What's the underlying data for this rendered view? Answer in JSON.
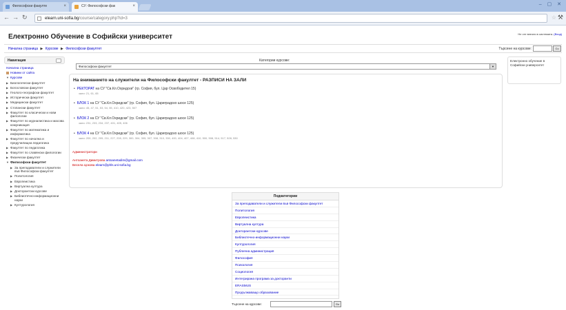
{
  "browser": {
    "tabs": [
      {
        "label": "Философски факулте"
      },
      {
        "label": "СУ: Философски фак"
      }
    ],
    "url_host": "elearn.uni-sofia.bg",
    "url_path": "/course/category.php?id=3"
  },
  "site": {
    "title": "Електронно Обучение в Софийски университет",
    "login_info": "Не сте влезли в системата.",
    "login_link": "(Вход)"
  },
  "breadcrumb": {
    "home": "Начална страница",
    "courses": "Курсове",
    "faculty": "Философски факултет",
    "sep": "▶"
  },
  "top_search": {
    "label": "Търсене на курсове:",
    "button": "Go"
  },
  "left_nav": {
    "title": "Навигация",
    "items": [
      {
        "label": "Начална страница",
        "kind": "link"
      },
      {
        "label": "Новини от сайта",
        "kind": "icon"
      },
      {
        "label": "Курсове",
        "kind": "link-open"
      },
      {
        "label": "Биологически факултет",
        "kind": "closed"
      },
      {
        "label": "Богословски факултет",
        "kind": "closed"
      },
      {
        "label": "Геолого-географски факултет",
        "kind": "closed"
      },
      {
        "label": "Исторически факултет",
        "kind": "closed"
      },
      {
        "label": "Медицински факултет",
        "kind": "closed"
      },
      {
        "label": "Стопански факултет",
        "kind": "closed"
      },
      {
        "label": "Факултет по класически и нови филологии",
        "kind": "closed"
      },
      {
        "label": "Факултет по журналистика и масова комуникация",
        "kind": "closed"
      },
      {
        "label": "Факултет по математика и информатика",
        "kind": "closed"
      },
      {
        "label": "Факултет по начална и предучилищна педагогика",
        "kind": "closed"
      },
      {
        "label": "Факултет по педагогика",
        "kind": "closed"
      },
      {
        "label": "Факултет по славянски филологии",
        "kind": "closed"
      },
      {
        "label": "Физически факултет",
        "kind": "closed"
      },
      {
        "label": "Философски факултет",
        "kind": "open-bold"
      },
      {
        "label": "За преподаватели и служители във Философски факултет",
        "kind": "sub"
      },
      {
        "label": "Политология",
        "kind": "sub"
      },
      {
        "label": "Европеистика",
        "kind": "sub"
      },
      {
        "label": "Виртуална култура",
        "kind": "sub"
      },
      {
        "label": "Докторантски курсове",
        "kind": "sub"
      },
      {
        "label": "Библиотечно-информационни науки",
        "kind": "sub"
      },
      {
        "label": "Културология",
        "kind": "sub"
      }
    ]
  },
  "category": {
    "label": "Категории курсове:",
    "selected": "Философски факултет"
  },
  "notice": {
    "title": "На вниманието на служители на Философски факултет - РАЗПИСИ НА ЗАЛИ",
    "buildings": [
      {
        "name": "РЕКТОРАТ",
        "rest": " на СУ \"Св.Кл.Охридски\" (гр. София, бул. Цар Освободител 15)",
        "rooms": "зали: 21, 61, 65"
      },
      {
        "name": "БЛОК 1",
        "rest": " на СУ \"Св.Кл.Охридски\" (гр. София, бул. Цариградско шосе 125)",
        "rooms": "зали: 45, 47, 51, 53, 54, 55, 410, 420, 423, 507"
      },
      {
        "name": "БЛОК 2",
        "rest": " на СУ \"Св.Кл.Охридски\" (гр. София, бул. Цариградско шосе 125)",
        "rooms": "зали: 231, 233, 234, 237, 401, 405, 406"
      },
      {
        "name": "БЛОК 4",
        "rest": " на СУ \"Св.Кл.Охридски\" (гр. София, бул. Цариградско шосе 125)",
        "rooms": "зали: 200, 202, 205, 211, 227, 228, 229, 300, 304, 305, 307, 308, 310, 330, 400, 404, 407, 408, 410, 500, 508, 514, 517, 528, 530"
      }
    ],
    "admin_label": "Администратори",
    "contacts": [
      {
        "name": "Антоанета Димитрова",
        "email": "antoanetadim@gmail.com"
      },
      {
        "name": "Весела Цокова",
        "email": "elearn@phls.uni-sofia.bg"
      }
    ]
  },
  "subcategories": {
    "title": "Подкатегории",
    "items": [
      "За преподаватели и служители във Философски факултет",
      "Политология",
      "Европеистика",
      "Виртуална култура",
      "Докторантски курсове",
      "Библиотечно-информационни науки",
      "Културология",
      "Публична администрация",
      "Философия",
      "Психология",
      "Социология",
      "Интегрирана програма за докторанти",
      "ERASMUS",
      "Продължаващо образование"
    ]
  },
  "bottom_search": {
    "label": "Търсене на курсове:",
    "button": "Go"
  },
  "right_block": {
    "text": "Електронно обучение в Софийски университет"
  }
}
